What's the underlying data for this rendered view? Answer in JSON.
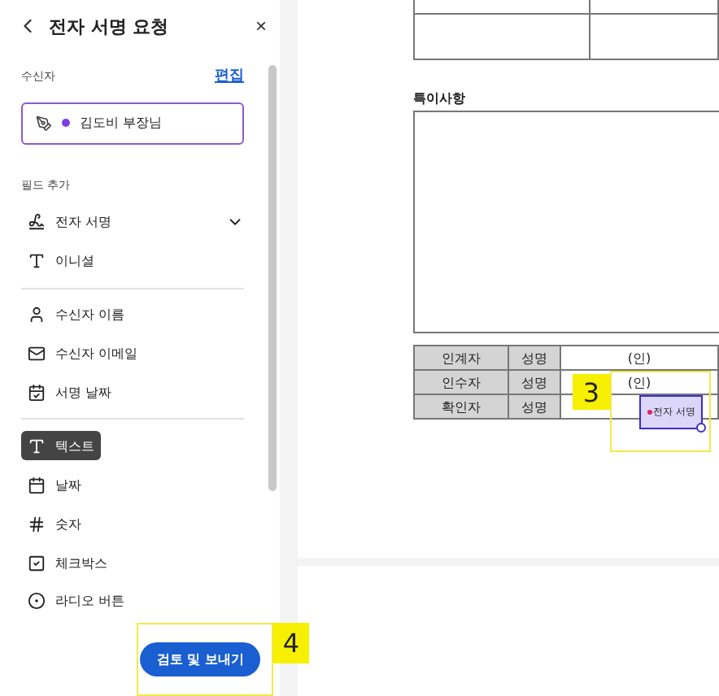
{
  "sidebar": {
    "title": "전자 서명 요청",
    "close": "×",
    "recipient_label": "수신자",
    "edit_link": "편집",
    "recipient": {
      "name": "김도비 부장님",
      "color": "#7b3fe4"
    },
    "fields_label": "필드 추가",
    "groups": [
      [
        {
          "label": "전자 서명",
          "kind": "signature",
          "dropdown": true,
          "selected": false
        },
        {
          "label": "이니셜",
          "kind": "initials",
          "dropdown": false,
          "selected": false
        }
      ],
      [
        {
          "label": "수신자 이름",
          "kind": "person",
          "dropdown": false,
          "selected": false
        },
        {
          "label": "수신자 이메일",
          "kind": "email",
          "dropdown": false,
          "selected": false
        },
        {
          "label": "서명 날짜",
          "kind": "date-signed",
          "dropdown": false,
          "selected": false
        }
      ],
      [
        {
          "label": "텍스트",
          "kind": "text",
          "dropdown": false,
          "selected": true
        },
        {
          "label": "날짜",
          "kind": "date",
          "dropdown": false,
          "selected": false
        },
        {
          "label": "숫자",
          "kind": "number",
          "dropdown": false,
          "selected": false
        },
        {
          "label": "체크박스",
          "kind": "checkbox",
          "dropdown": false,
          "selected": false
        },
        {
          "label": "라디오 버튼",
          "kind": "radio",
          "dropdown": false,
          "selected": false
        }
      ]
    ],
    "submit": "검토 및 보내기"
  },
  "document": {
    "notes_heading": "특이사항",
    "sign_rows": [
      {
        "role": "인계자",
        "label": "성명",
        "seal": "(인)"
      },
      {
        "role": "인수자",
        "label": "성명",
        "seal": "(인)"
      },
      {
        "role": "확인자",
        "label": "성명",
        "seal": ""
      }
    ],
    "signature_field": {
      "label": "전자 서명"
    }
  },
  "callouts": [
    {
      "number": "3"
    },
    {
      "number": "4"
    }
  ]
}
